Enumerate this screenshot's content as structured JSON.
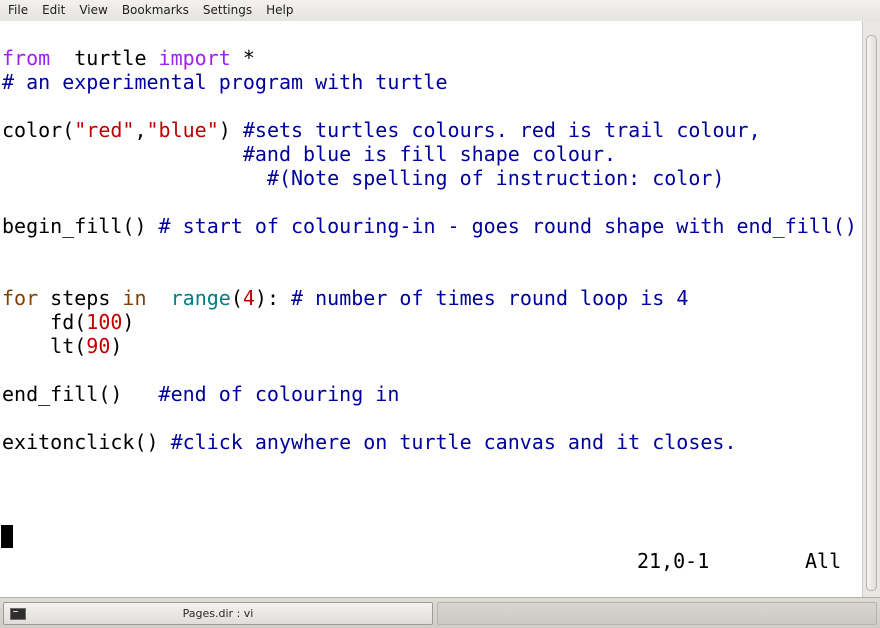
{
  "menubar": {
    "items": [
      "File",
      "Edit",
      "View",
      "Bookmarks",
      "Settings",
      "Help"
    ]
  },
  "editor": {
    "lines": [
      [
        {
          "t": "from",
          "c": "kw"
        },
        {
          "t": "  turtle ",
          "c": "plain"
        },
        {
          "t": "import",
          "c": "kw"
        },
        {
          "t": " *",
          "c": "plain"
        }
      ],
      [
        {
          "t": "# an experimental program with turtle",
          "c": "cmt"
        }
      ],
      [],
      [
        {
          "t": "color(",
          "c": "plain"
        },
        {
          "t": "\"red\"",
          "c": "str"
        },
        {
          "t": ",",
          "c": "plain"
        },
        {
          "t": "\"blue\"",
          "c": "str"
        },
        {
          "t": ") ",
          "c": "plain"
        },
        {
          "t": "#sets turtles colours. red is trail colour,",
          "c": "cmt"
        }
      ],
      [
        {
          "t": "                    ",
          "c": "plain"
        },
        {
          "t": "#and blue is fill shape colour.",
          "c": "cmt"
        }
      ],
      [
        {
          "t": "                      ",
          "c": "plain"
        },
        {
          "t": "#(Note spelling of instruction: color)",
          "c": "cmt"
        }
      ],
      [],
      [
        {
          "t": "begin_fill() ",
          "c": "plain"
        },
        {
          "t": "# start of colouring-in - goes round shape with end_fill()",
          "c": "cmt"
        }
      ],
      [],
      [],
      [
        {
          "t": "for",
          "c": "stmt"
        },
        {
          "t": " steps ",
          "c": "plain"
        },
        {
          "t": "in",
          "c": "stmt"
        },
        {
          "t": "  ",
          "c": "plain"
        },
        {
          "t": "range",
          "c": "builtin"
        },
        {
          "t": "(",
          "c": "plain"
        },
        {
          "t": "4",
          "c": "num"
        },
        {
          "t": "): ",
          "c": "plain"
        },
        {
          "t": "# number of times round loop is 4",
          "c": "cmt"
        }
      ],
      [
        {
          "t": "    fd(",
          "c": "plain"
        },
        {
          "t": "100",
          "c": "num"
        },
        {
          "t": ")",
          "c": "plain"
        }
      ],
      [
        {
          "t": "    lt(",
          "c": "plain"
        },
        {
          "t": "90",
          "c": "num"
        },
        {
          "t": ")",
          "c": "plain"
        }
      ],
      [],
      [
        {
          "t": "end_fill()   ",
          "c": "plain"
        },
        {
          "t": "#end of colouring in",
          "c": "cmt"
        }
      ],
      [],
      [
        {
          "t": "exitonclick() ",
          "c": "plain"
        },
        {
          "t": "#click anywhere on turtle canvas and it closes.",
          "c": "cmt"
        }
      ]
    ],
    "ruler_position": "21,0-1",
    "ruler_scroll": "All"
  },
  "taskbar": {
    "task_title": "Pages.dir : vi"
  },
  "colors": {
    "keyword": "#a020f0",
    "statement": "#804000",
    "builtin": "#008080",
    "string_number": "#c00000",
    "comment": "#0000a0"
  }
}
